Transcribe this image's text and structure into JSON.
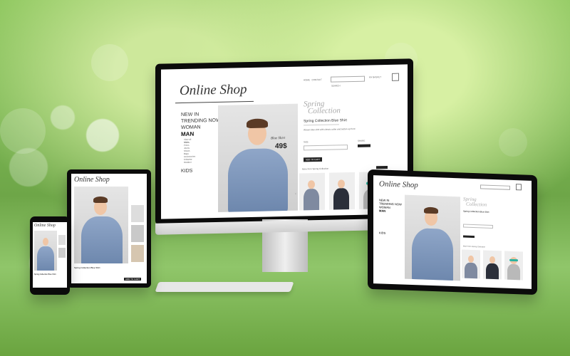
{
  "desktop": {
    "logo": "Online Shop",
    "nav_links": [
      "HOME",
      "CONTACT"
    ],
    "search_placeholder": "SEARCH",
    "cart_label": "MY BASKET",
    "menu": [
      "NEW IN",
      "TRENDING NOW",
      "WOMAN",
      "MAN",
      "View all",
      "Shirts",
      "Polos",
      "Jeans",
      "Shoes",
      "Bags",
      "Accessories",
      "Knitwear",
      "Outdoor",
      "KIDS"
    ],
    "collection_title_line1": "Spring",
    "collection_title_line2": "Collection",
    "product_name": "Spring Collection Blue Shirt",
    "product_desc": "Woven blue shirt with classic collar and button-up front",
    "price_label": "Blue Shirt",
    "price_value": "49$",
    "size_label": "SIZE",
    "share_label": "SHARE",
    "add_button": "ADD TO CART",
    "more_label": "More from Spring Collection"
  },
  "tablet_left": {
    "logo": "Online Shop",
    "product_name": "Spring Collection Blue Shirt",
    "add_button": "ADD TO CART"
  },
  "tablet_right": {
    "logo": "Online Shop",
    "menu": [
      "NEW IN",
      "TRENDING NOW",
      "WOMAN",
      "MAN",
      "KIDS"
    ],
    "collection_title_line1": "Spring",
    "collection_title_line2": "Collection",
    "product_name": "Spring Collection Blue Shirt",
    "more_label": "More from Spring Collection"
  },
  "phone": {
    "logo": "Online Shop",
    "product_name": "Spring Collection Blue Shirt"
  }
}
